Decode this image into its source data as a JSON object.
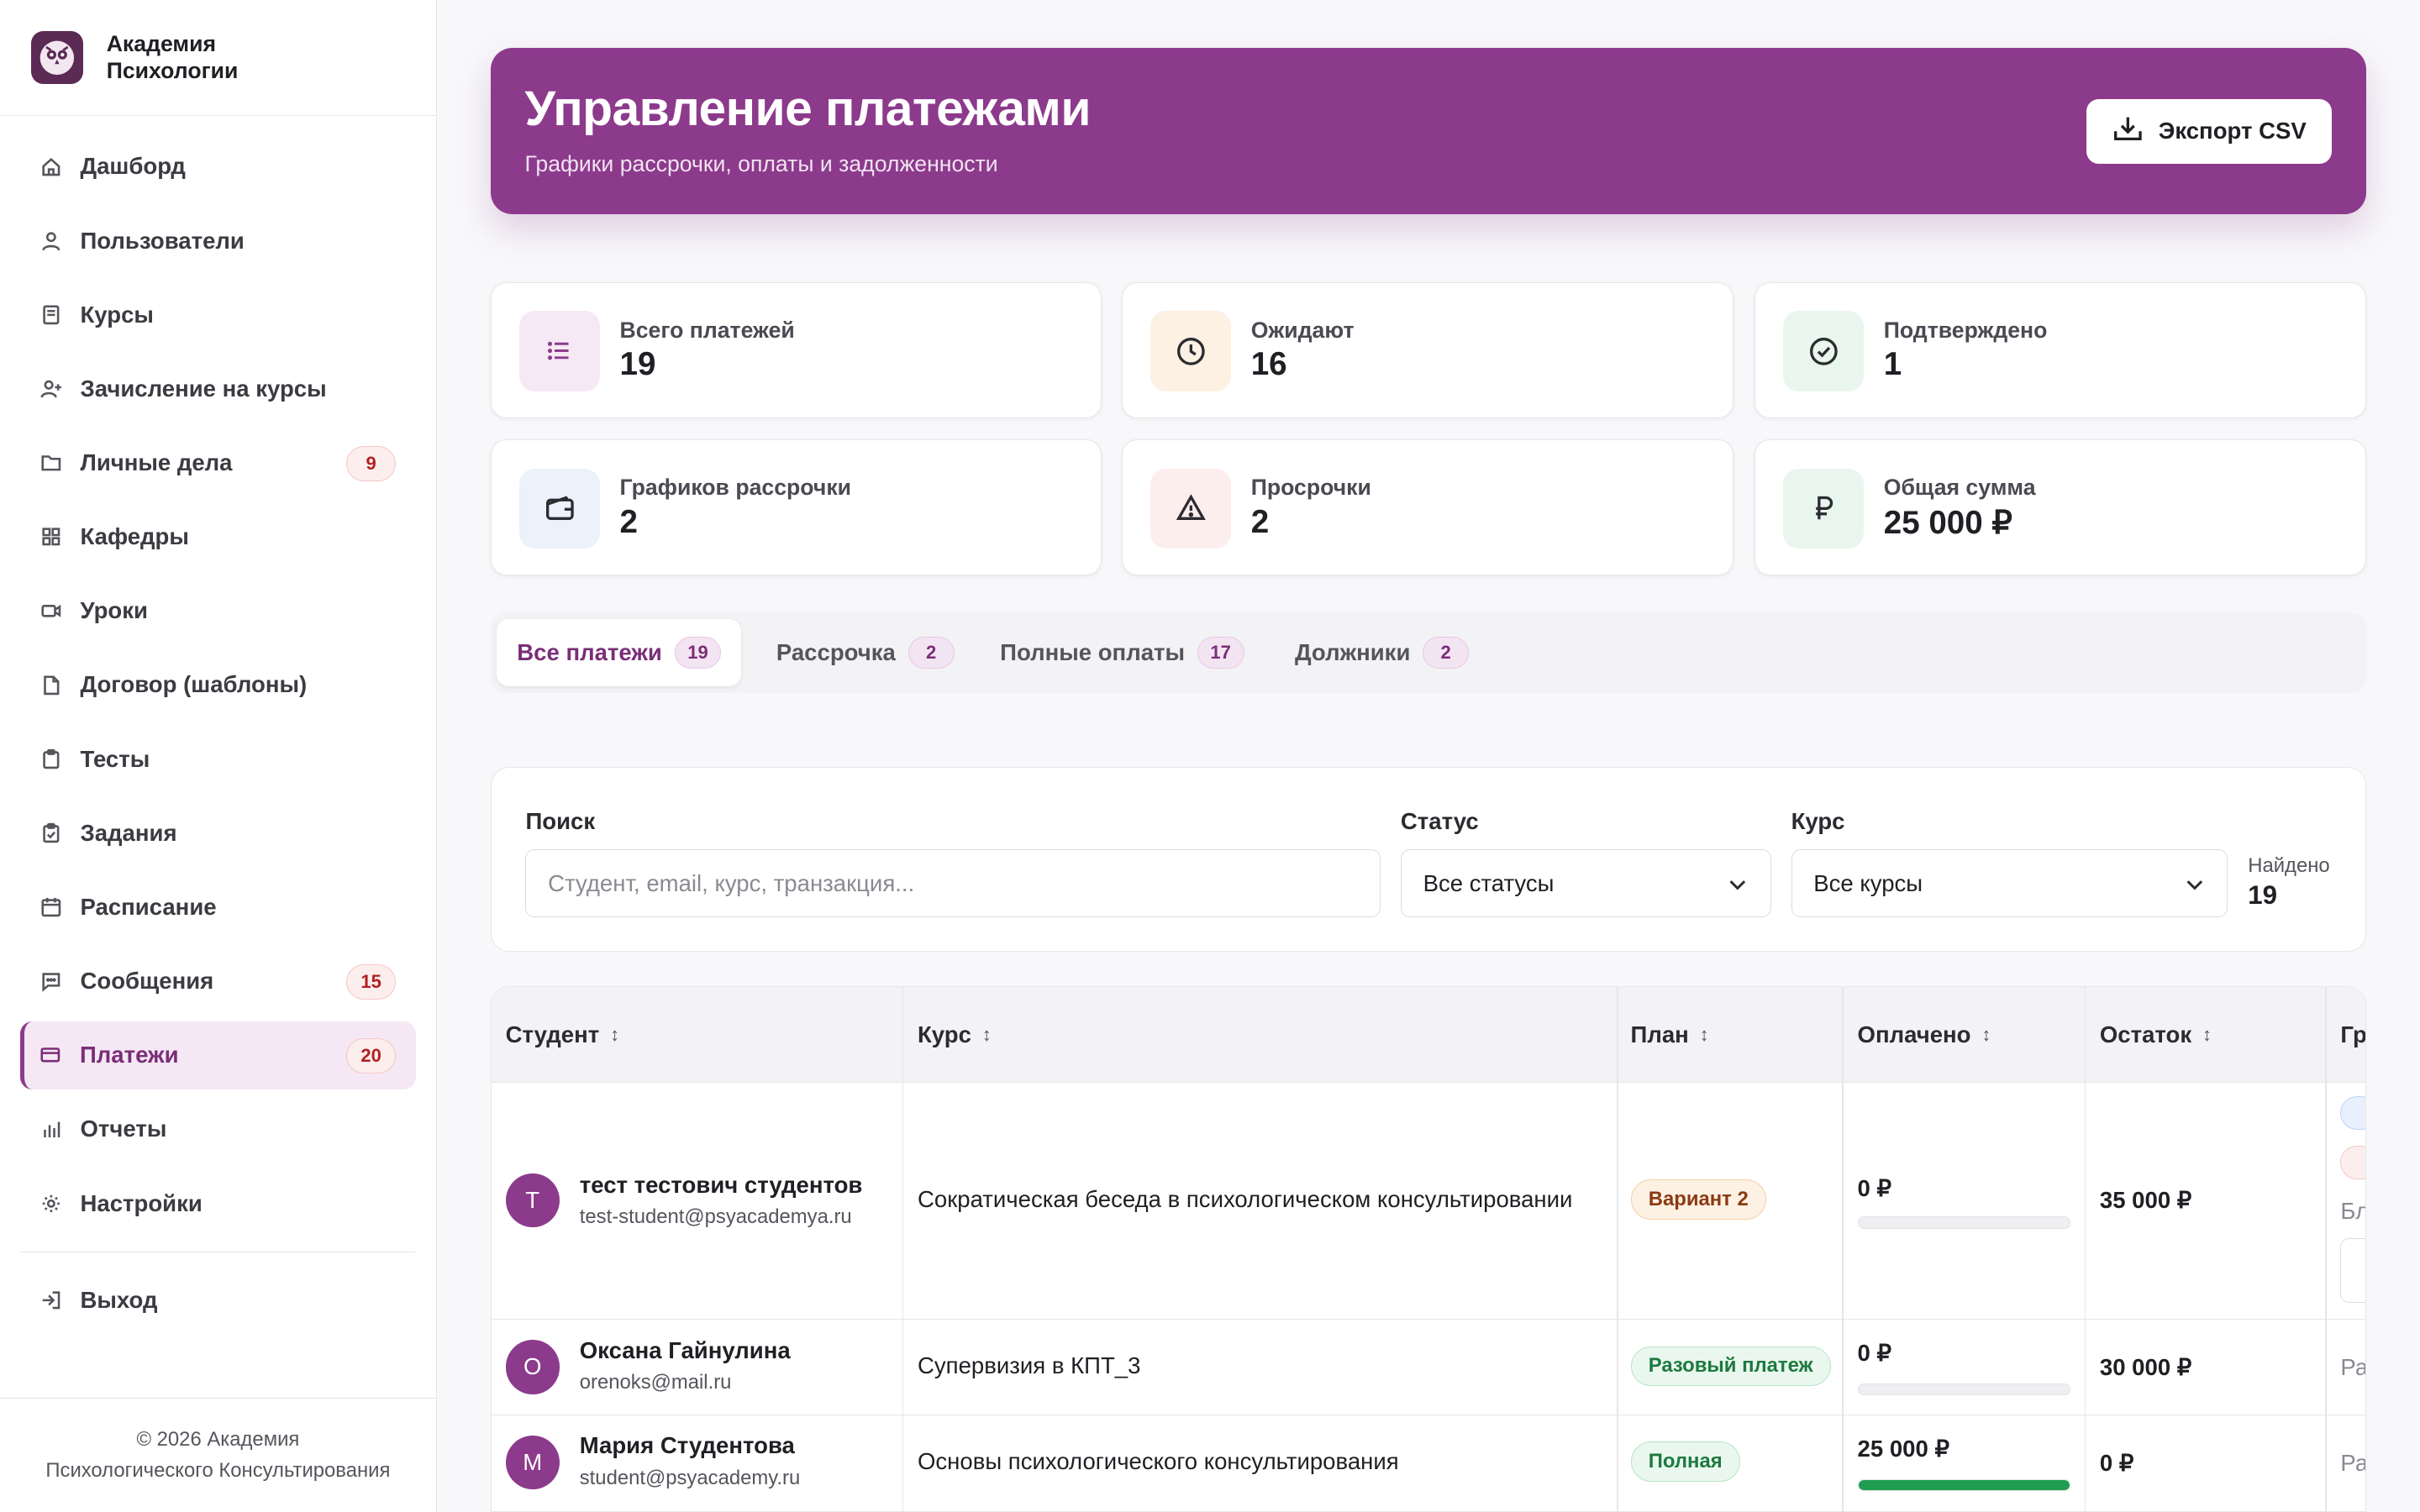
{
  "brand": {
    "line1": "Академия",
    "line2": "Психологии"
  },
  "nav": {
    "items": [
      {
        "label": "Дашборд",
        "icon": "home-icon"
      },
      {
        "label": "Пользователи",
        "icon": "user-icon"
      },
      {
        "label": "Курсы",
        "icon": "book-icon"
      },
      {
        "label": "Зачисление на курсы",
        "icon": "user-plus-icon"
      },
      {
        "label": "Личные дела",
        "icon": "folder-icon",
        "badge": "9"
      },
      {
        "label": "Кафедры",
        "icon": "grid-icon"
      },
      {
        "label": "Уроки",
        "icon": "video-icon"
      },
      {
        "label": "Договор (шаблоны)",
        "icon": "file-icon"
      },
      {
        "label": "Тесты",
        "icon": "clipboard-icon"
      },
      {
        "label": "Задания",
        "icon": "clipboard-check-icon"
      },
      {
        "label": "Расписание",
        "icon": "calendar-icon"
      },
      {
        "label": "Сообщения",
        "icon": "message-icon",
        "badge": "15"
      },
      {
        "label": "Платежи",
        "icon": "credit-card-icon",
        "badge": "20",
        "active": true
      },
      {
        "label": "Отчеты",
        "icon": "bar-chart-icon"
      },
      {
        "label": "Настройки",
        "icon": "gear-icon"
      }
    ],
    "logout": "Выход"
  },
  "footer": {
    "line1": "© 2026 Академия",
    "line2": "Психологического Консультирования"
  },
  "header": {
    "title": "Управление платежами",
    "subtitle": "Графики рассрочки, оплаты и задолженности",
    "export_label": "Экспорт CSV"
  },
  "stats": [
    {
      "label": "Всего платежей",
      "value": "19",
      "icon": "list-icon"
    },
    {
      "label": "Ожидают",
      "value": "16",
      "icon": "clock-icon"
    },
    {
      "label": "Подтверждено",
      "value": "1",
      "icon": "check-circle-icon"
    },
    {
      "label": "Графиков рассрочки",
      "value": "2",
      "icon": "wallet-icon"
    },
    {
      "label": "Просрочки",
      "value": "2",
      "icon": "warning-icon"
    },
    {
      "label": "Общая сумма",
      "value": "25 000 ₽",
      "icon": "ruble-icon"
    }
  ],
  "tabs": [
    {
      "label": "Все платежи",
      "count": "19"
    },
    {
      "label": "Рассрочка",
      "count": "2"
    },
    {
      "label": "Полные оплаты",
      "count": "17"
    },
    {
      "label": "Должники",
      "count": "2"
    }
  ],
  "filters": {
    "search_label": "Поиск",
    "search_placeholder": "Студент, email, курс, транзакция...",
    "status_label": "Статус",
    "status_value": "Все статусы",
    "course_label": "Курс",
    "course_value": "Все курсы",
    "found_label": "Найдено",
    "found_value": "19"
  },
  "table": {
    "columns": [
      "Студент",
      "Курс",
      "План",
      "Оплачено",
      "Остаток",
      "Гр"
    ],
    "rows": [
      {
        "initial": "Т",
        "name": "тест тестович студентов",
        "email": "test-student@psyacademya.ru",
        "course": "Сократическая беседа в психологическом консультировании",
        "plan": "Вариант 2",
        "paid": "0 ₽",
        "paid_fraction": 0,
        "rest": "35 000 ₽",
        "extra": "Бл"
      },
      {
        "initial": "О",
        "name": "Оксана Гайнулина",
        "email": "orenoks@mail.ru",
        "course": "Супервизия в КПТ_3",
        "plan": "Разовый платеж",
        "paid": "0 ₽",
        "paid_fraction": 0,
        "rest": "30 000 ₽",
        "extra": "Ра"
      },
      {
        "initial": "М",
        "name": "Мария Студентова",
        "email": "student@psyacademy.ru",
        "course": "Основы психологического консультирования",
        "plan": "Полная",
        "paid": "25 000 ₽",
        "paid_fraction": 1,
        "rest": "0 ₽",
        "extra": "Ра"
      }
    ]
  },
  "colors": {
    "accent": "#8c3a8c",
    "progress": "#1f9d50",
    "badge_red": "#b02121"
  }
}
